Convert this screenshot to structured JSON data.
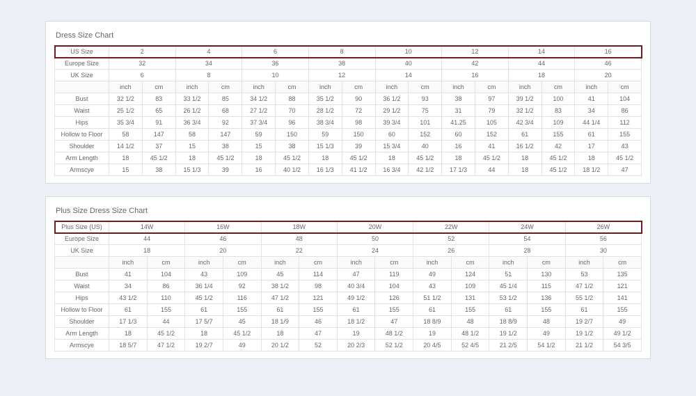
{
  "chart1": {
    "title": "Dress Size Chart",
    "sizeRows": [
      {
        "label": "US Size",
        "values": [
          "2",
          "4",
          "6",
          "8",
          "10",
          "12",
          "14",
          "16"
        ],
        "highlight": true
      },
      {
        "label": "Europe Size",
        "values": [
          "32",
          "34",
          "36",
          "38",
          "40",
          "42",
          "44",
          "46"
        ]
      },
      {
        "label": "UK Size",
        "values": [
          "6",
          "8",
          "10",
          "12",
          "14",
          "16",
          "18",
          "20"
        ]
      }
    ],
    "unitLabels": {
      "inch": "inch",
      "cm": "cm"
    },
    "measureRows": [
      {
        "label": "Bust",
        "pairs": [
          [
            "32 1/2",
            "83"
          ],
          [
            "33 1/2",
            "85"
          ],
          [
            "34 1/2",
            "88"
          ],
          [
            "35 1/2",
            "90"
          ],
          [
            "36 1/2",
            "93"
          ],
          [
            "38",
            "97"
          ],
          [
            "39 1/2",
            "100"
          ],
          [
            "41",
            "104"
          ]
        ]
      },
      {
        "label": "Waist",
        "pairs": [
          [
            "25 1/2",
            "65"
          ],
          [
            "26 1/2",
            "68"
          ],
          [
            "27 1/2",
            "70"
          ],
          [
            "28 1/2",
            "72"
          ],
          [
            "29 1/2",
            "75"
          ],
          [
            "31",
            "79"
          ],
          [
            "32 1/2",
            "83"
          ],
          [
            "34",
            "86"
          ]
        ]
      },
      {
        "label": "Hips",
        "pairs": [
          [
            "35 3/4",
            "91"
          ],
          [
            "36 3/4",
            "92"
          ],
          [
            "37 3/4",
            "96"
          ],
          [
            "38 3/4",
            "98"
          ],
          [
            "39 3/4",
            "101"
          ],
          [
            "41.25",
            "105"
          ],
          [
            "42 3/4",
            "109"
          ],
          [
            "44 1/4",
            "112"
          ]
        ]
      },
      {
        "label": "Hollow to Floor",
        "pairs": [
          [
            "58",
            "147"
          ],
          [
            "58",
            "147"
          ],
          [
            "59",
            "150"
          ],
          [
            "59",
            "150"
          ],
          [
            "60",
            "152"
          ],
          [
            "60",
            "152"
          ],
          [
            "61",
            "155"
          ],
          [
            "61",
            "155"
          ]
        ]
      },
      {
        "label": "Shoulder",
        "pairs": [
          [
            "14 1/2",
            "37"
          ],
          [
            "15",
            "38"
          ],
          [
            "15",
            "38"
          ],
          [
            "15 1/3",
            "39"
          ],
          [
            "15 3/4",
            "40"
          ],
          [
            "16",
            "41"
          ],
          [
            "16 1/2",
            "42"
          ],
          [
            "17",
            "43"
          ]
        ]
      },
      {
        "label": "Arm Length",
        "pairs": [
          [
            "18",
            "45 1/2"
          ],
          [
            "18",
            "45 1/2"
          ],
          [
            "18",
            "45 1/2"
          ],
          [
            "18",
            "45 1/2"
          ],
          [
            "18",
            "45 1/2"
          ],
          [
            "18",
            "45 1/2"
          ],
          [
            "18",
            "45 1/2"
          ],
          [
            "18",
            "45 1/2"
          ]
        ]
      },
      {
        "label": "Armscye",
        "pairs": [
          [
            "15",
            "38"
          ],
          [
            "15 1/3",
            "39"
          ],
          [
            "16",
            "40 1/2"
          ],
          [
            "16 1/3",
            "41 1/2"
          ],
          [
            "16 3/4",
            "42 1/2"
          ],
          [
            "17 1/3",
            "44"
          ],
          [
            "18",
            "45 1/2"
          ],
          [
            "18 1/2",
            "47"
          ]
        ]
      }
    ]
  },
  "chart2": {
    "title": "Plus Size Dress Size Chart",
    "sizeRows": [
      {
        "label": "Plus Size (US)",
        "values": [
          "14W",
          "16W",
          "18W",
          "20W",
          "22W",
          "24W",
          "26W"
        ],
        "highlight": true
      },
      {
        "label": "Europe Size",
        "values": [
          "44",
          "46",
          "48",
          "50",
          "52",
          "54",
          "56"
        ]
      },
      {
        "label": "UK Size",
        "values": [
          "18",
          "20",
          "22",
          "24",
          "26",
          "28",
          "30"
        ]
      }
    ],
    "unitLabels": {
      "inch": "inch",
      "cm": "cm"
    },
    "measureRows": [
      {
        "label": "Bust",
        "pairs": [
          [
            "41",
            "104"
          ],
          [
            "43",
            "109"
          ],
          [
            "45",
            "114"
          ],
          [
            "47",
            "119"
          ],
          [
            "49",
            "124"
          ],
          [
            "51",
            "130"
          ],
          [
            "53",
            "135"
          ]
        ]
      },
      {
        "label": "Waist",
        "pairs": [
          [
            "34",
            "86"
          ],
          [
            "36 1/4",
            "92"
          ],
          [
            "38 1/2",
            "98"
          ],
          [
            "40 3/4",
            "104"
          ],
          [
            "43",
            "109"
          ],
          [
            "45 1/4",
            "115"
          ],
          [
            "47 1/2",
            "121"
          ]
        ]
      },
      {
        "label": "Hips",
        "pairs": [
          [
            "43 1/2",
            "110"
          ],
          [
            "45 1/2",
            "116"
          ],
          [
            "47 1/2",
            "121"
          ],
          [
            "49 1/2",
            "126"
          ],
          [
            "51 1/2",
            "131"
          ],
          [
            "53 1/2",
            "136"
          ],
          [
            "55 1/2",
            "141"
          ]
        ]
      },
      {
        "label": "Hollow to Floor",
        "pairs": [
          [
            "61",
            "155"
          ],
          [
            "61",
            "155"
          ],
          [
            "61",
            "155"
          ],
          [
            "61",
            "155"
          ],
          [
            "61",
            "155"
          ],
          [
            "61",
            "155"
          ],
          [
            "61",
            "155"
          ]
        ]
      },
      {
        "label": "Shoulder",
        "pairs": [
          [
            "17 1/3",
            "44"
          ],
          [
            "17 5/7",
            "45"
          ],
          [
            "18 1/9",
            "46"
          ],
          [
            "18 1/2",
            "47"
          ],
          [
            "18 8/9",
            "48"
          ],
          [
            "18 8/9",
            "48"
          ],
          [
            "19 2/7",
            "49"
          ]
        ]
      },
      {
        "label": "Arm Length",
        "pairs": [
          [
            "18",
            "45 1/2"
          ],
          [
            "18",
            "45 1/2"
          ],
          [
            "18",
            "47"
          ],
          [
            "19",
            "48 1/2"
          ],
          [
            "19",
            "48 1/2"
          ],
          [
            "19 1/2",
            "49"
          ],
          [
            "19 1/2",
            "49 1/2"
          ]
        ]
      },
      {
        "label": "Armscye",
        "pairs": [
          [
            "18 5/7",
            "47 1/2"
          ],
          [
            "19 2/7",
            "49"
          ],
          [
            "20 1/2",
            "52"
          ],
          [
            "20 2/3",
            "52 1/2"
          ],
          [
            "20 4/5",
            "52 4/5"
          ],
          [
            "21 2/5",
            "54 1/2"
          ],
          [
            "21 1/2",
            "54 3/5"
          ]
        ]
      }
    ]
  }
}
